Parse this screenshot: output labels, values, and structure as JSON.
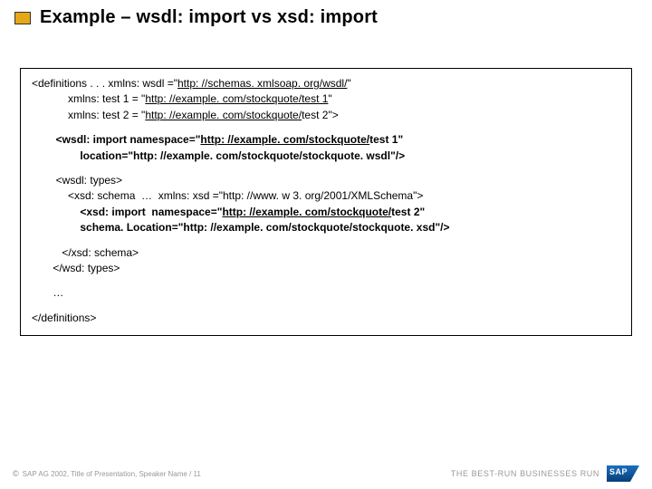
{
  "header": {
    "title": "Example – wsdl: import vs xsd: import"
  },
  "code": {
    "l1a": "<definitions . . . xmlns: wsdl =\"",
    "l1link": "http: //schemas. xmlsoap. org/wsdl/",
    "l1b": "\"",
    "l2a": "            xmlns: test 1 = \"",
    "l2link": "http: //example. com/stockquote/test 1",
    "l2b": "\"",
    "l3a": "            xmlns: test 2 = \"",
    "l3link": "http: //example. com/stockquote/",
    "l3mid": "test 2",
    "l3b": "\">",
    "wi1a": "        <wsdl: import namespace=\"",
    "wi1link": "http: //example. com/stockquote/",
    "wi1mid": "test 1",
    "wi1b": "\"",
    "wi2": "                location=\"http: //example. com/stockquote/stockquote. wsdl\"/>",
    "wt": "        <wsdl: types>",
    "xs1": "            <xsd: schema  …  xmlns: xsd =\"http: //www. w 3. org/2001/XMLSchema\">",
    "xi1a": "                <xsd: import  namespace=\"",
    "xi1link": "http: //example. com/stockquote/",
    "xi1mid": "test 2",
    "xi1b": "\"",
    "xi2": "                schema. Location=\"http: //example. com/stockquote/stockquote. xsd\"/>",
    "xc": "          </xsd: schema>",
    "wtc": "       </wsd: types>",
    "dots": "       …",
    "def_end": "</definitions>"
  },
  "footer": {
    "copyright_symbol": "©",
    "text": "SAP AG 2002, Title of Presentation, Speaker Name / 11",
    "tagline": "THE BEST-RUN BUSINESSES RUN"
  }
}
